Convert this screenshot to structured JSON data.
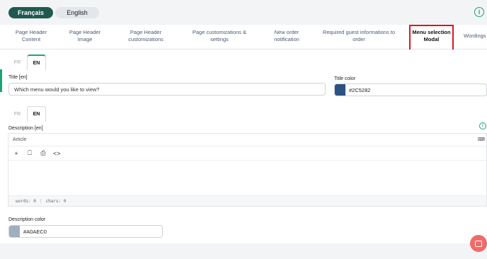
{
  "languages": {
    "fr": "Français",
    "en": "English"
  },
  "tabs": [
    {
      "label_line1": "Page Header",
      "label_line2": "Content"
    },
    {
      "label_line1": "Page Header",
      "label_line2": "Image"
    },
    {
      "label_line1": "Page Header",
      "label_line2": "customizations"
    },
    {
      "label_line1": "Page customizations &",
      "label_line2": "settings"
    },
    {
      "label_line1": "New order",
      "label_line2": "notification"
    },
    {
      "label_line1": "Required guest informations to",
      "label_line2": "order"
    },
    {
      "label_line1": "Menu selection",
      "label_line2": "Modal"
    },
    {
      "label_line1": "Wordings",
      "label_line2": ""
    }
  ],
  "title_section": {
    "lang_tabs": [
      "FR",
      "EN"
    ],
    "title_label": "Title [en]",
    "title_value": "Which menu would you like to view?",
    "color_label": "Title color",
    "color_value": "#2C5282",
    "color_hex": "#2C5282"
  },
  "description_section": {
    "lang_tabs": [
      "FR",
      "EN"
    ],
    "label": "Description [en]",
    "editor_style": "Article",
    "footer_words": "words: 0",
    "footer_chars": "chars: 0",
    "color_label": "Description color",
    "color_value": "#A0AEC0",
    "color_hex": "#A0AEC0"
  },
  "toolbar": {
    "plus": "+",
    "bookmark": "⎕",
    "print": "⎙",
    "code": "<>"
  }
}
